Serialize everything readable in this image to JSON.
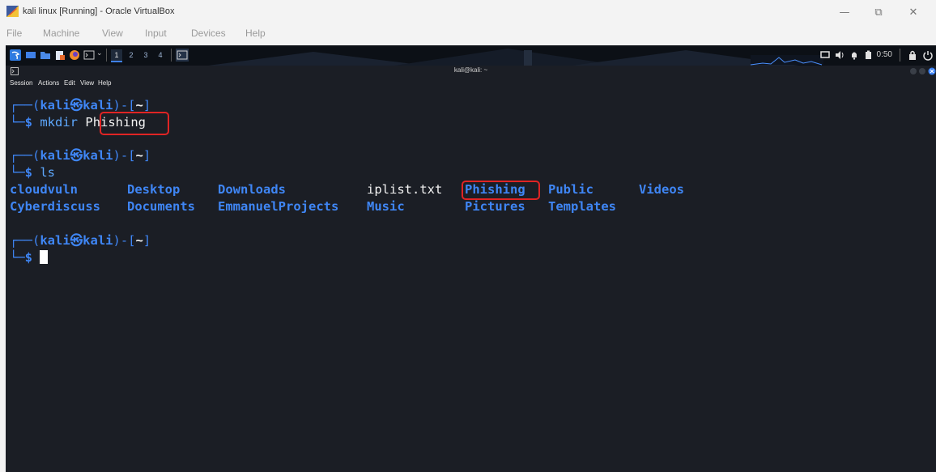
{
  "window": {
    "title": "kali linux [Running] - Oracle VirtualBox",
    "controls": {
      "minimize": "—",
      "maximize": "⧉",
      "close": "✕"
    }
  },
  "vbox_menu": [
    "File",
    "Machine",
    "View",
    "Input",
    "Devices",
    "Help"
  ],
  "panel": {
    "workspaces": [
      "1",
      "2",
      "3",
      "4"
    ],
    "clock": "0:50"
  },
  "terminal": {
    "title": "kali@kali: ~",
    "menu": [
      "Session",
      "Actions",
      "Edit",
      "View",
      "Help"
    ],
    "prompt": {
      "open": "┌──(",
      "user": "kali",
      "at": "㉿",
      "host": "kali",
      "mid": ")-[",
      "path": "~",
      "close": "]",
      "dollar": "└─$"
    },
    "commands": [
      {
        "cmd": "mkdir",
        "arg": "Phishing"
      },
      {
        "cmd": "ls",
        "arg": ""
      }
    ],
    "ls_output": {
      "row1": [
        {
          "name": "cloudvuln",
          "type": "dir"
        },
        {
          "name": "Desktop",
          "type": "dir"
        },
        {
          "name": "Downloads",
          "type": "dir"
        },
        {
          "name": "iplist.txt",
          "type": "file"
        },
        {
          "name": "Phishing",
          "type": "dir"
        },
        {
          "name": "Public",
          "type": "dir"
        },
        {
          "name": "Videos",
          "type": "dir"
        }
      ],
      "row2": [
        {
          "name": "Cyberdiscuss",
          "type": "dir"
        },
        {
          "name": "Documents",
          "type": "dir"
        },
        {
          "name": "EmmanuelProjects",
          "type": "dir"
        },
        {
          "name": "Music",
          "type": "dir"
        },
        {
          "name": "Pictures",
          "type": "dir"
        },
        {
          "name": "Templates",
          "type": "dir"
        }
      ]
    }
  },
  "colors": {
    "terminal_bg": "#1b1e25",
    "prompt_blue": "#3f86f5",
    "highlight_red": "#e02424"
  }
}
